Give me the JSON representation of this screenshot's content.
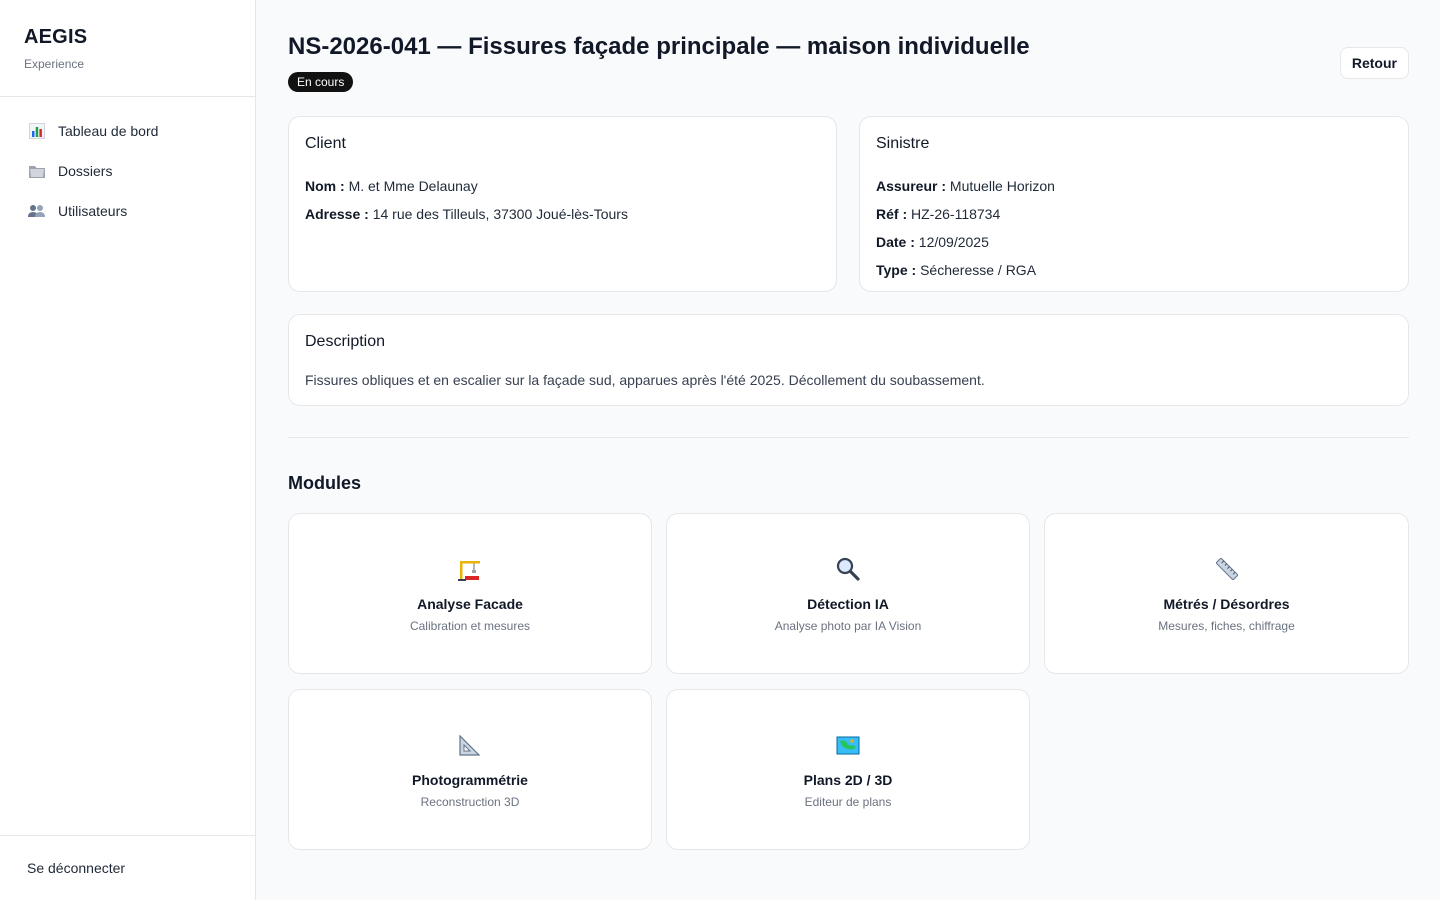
{
  "brand": {
    "name": "AEGIS",
    "subtitle": "Experience"
  },
  "sidebar": {
    "items": [
      {
        "label": "Tableau de bord",
        "icon": "bar-chart-icon"
      },
      {
        "label": "Dossiers",
        "icon": "folder-icon"
      },
      {
        "label": "Utilisateurs",
        "icon": "users-icon"
      }
    ],
    "logout_label": "Se déconnecter"
  },
  "header": {
    "title": "NS-2026-041 — Fissures façade principale — maison individuelle",
    "status": "En cours",
    "back_label": "Retour"
  },
  "client": {
    "title": "Client",
    "nom_label": "Nom :",
    "nom": "M. et Mme Delaunay",
    "adresse_label": "Adresse :",
    "adresse": "14 rue des Tilleuls, 37300 Joué-lès-Tours"
  },
  "sinistre": {
    "title": "Sinistre",
    "assureur_label": "Assureur :",
    "assureur": "Mutuelle Horizon",
    "ref_label": "Réf :",
    "ref": "HZ-26-118734",
    "date_label": "Date :",
    "date": "12/09/2025",
    "type_label": "Type :",
    "type": "Sécheresse / RGA"
  },
  "description": {
    "title": "Description",
    "text": "Fissures obliques et en escalier sur la façade sud, apparues après l'été 2025. Décollement du soubassement."
  },
  "modules": {
    "title": "Modules",
    "items": [
      {
        "name": "Analyse Facade",
        "desc": "Calibration et mesures",
        "icon": "crane-icon"
      },
      {
        "name": "Détection IA",
        "desc": "Analyse photo par IA Vision",
        "icon": "magnifier-icon"
      },
      {
        "name": "Métrés / Désordres",
        "desc": "Mesures, fiches, chiffrage",
        "icon": "ruler-icon"
      },
      {
        "name": "Photogrammétrie",
        "desc": "Reconstruction 3D",
        "icon": "triangle-ruler-icon"
      },
      {
        "name": "Plans 2D / 3D",
        "desc": "Editeur de plans",
        "icon": "map-icon"
      }
    ]
  },
  "colors": {
    "badge_bg": "#111111",
    "border": "#e5e7eb",
    "background": "#f9fafb"
  }
}
